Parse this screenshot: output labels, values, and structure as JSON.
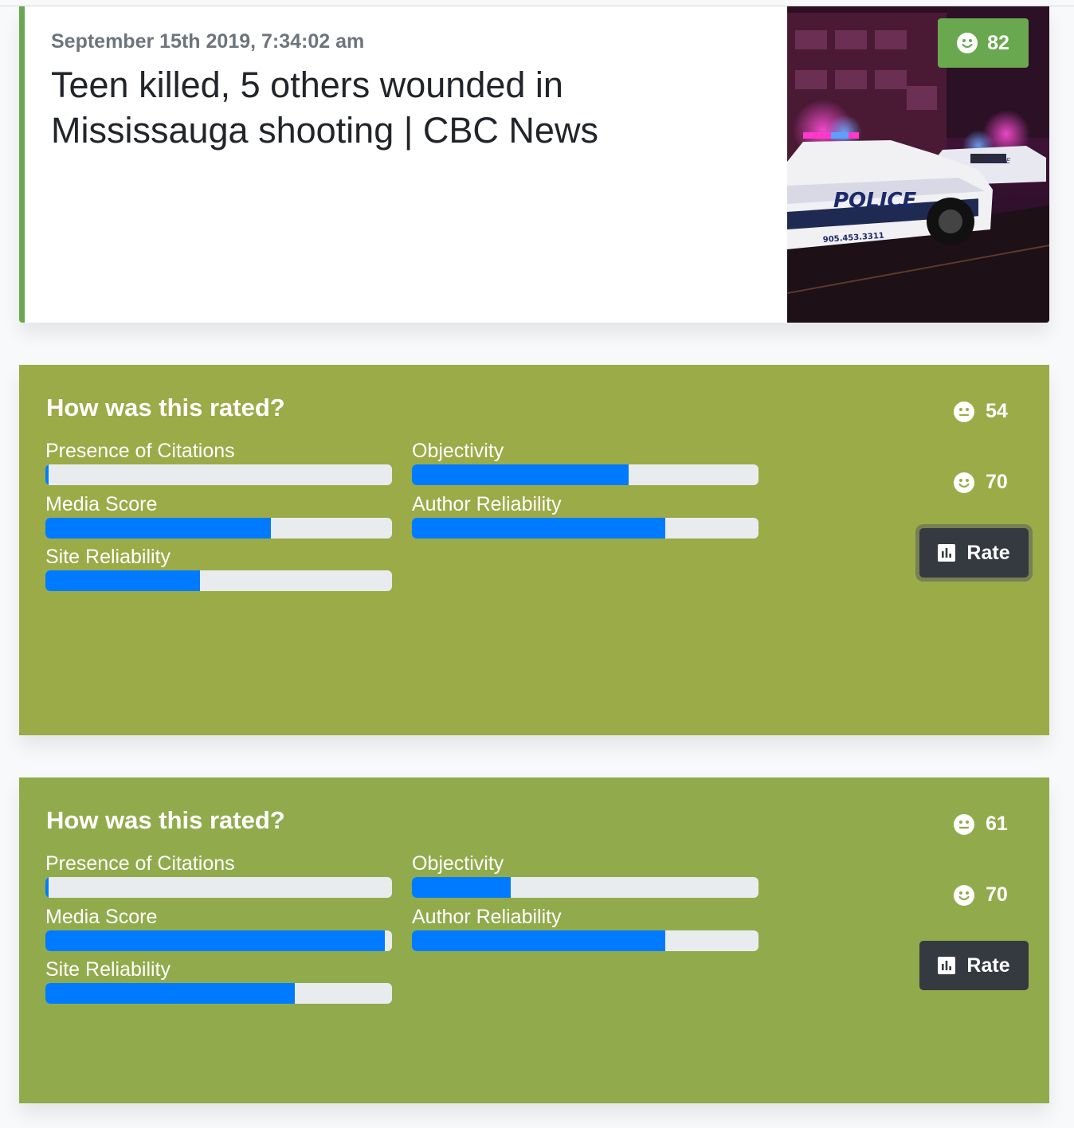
{
  "article": {
    "date": "September 15th 2019, 7:34:02 am",
    "title": "Teen killed, 5 others wounded in Mississauga shooting | CBC News",
    "score": "82",
    "image_alt": "Police cars with flashing lights at night",
    "accent_color": "#6aa84f"
  },
  "panels": [
    {
      "heading": "How was this rated?",
      "background": "#9aab48",
      "metrics": {
        "citations": {
          "label": "Presence of Citations",
          "value": 0.01
        },
        "objectivity": {
          "label": "Objectivity",
          "value": 0.625
        },
        "media": {
          "label": "Media Score",
          "value": 0.65
        },
        "author": {
          "label": "Author Reliability",
          "value": 0.73
        },
        "site": {
          "label": "Site Reliability",
          "value": 0.445
        }
      },
      "score_a": {
        "icon": "neutral-face-icon",
        "value": "54"
      },
      "score_b": {
        "icon": "smile-face-icon",
        "value": "70"
      },
      "rate_label": "Rate"
    },
    {
      "heading": "How was this rated?",
      "background": "#91ab4c",
      "metrics": {
        "citations": {
          "label": "Presence of Citations",
          "value": 0.01
        },
        "objectivity": {
          "label": "Objectivity",
          "value": 0.285
        },
        "media": {
          "label": "Media Score",
          "value": 0.98
        },
        "author": {
          "label": "Author Reliability",
          "value": 0.73
        },
        "site": {
          "label": "Site Reliability",
          "value": 0.72
        }
      },
      "score_a": {
        "icon": "neutral-face-icon",
        "value": "61"
      },
      "score_b": {
        "icon": "smile-face-icon",
        "value": "70"
      },
      "rate_label": "Rate"
    }
  ],
  "colors": {
    "bar_fill": "#007bff",
    "bar_track": "#e9ecef",
    "button_dark": "#343a40"
  }
}
